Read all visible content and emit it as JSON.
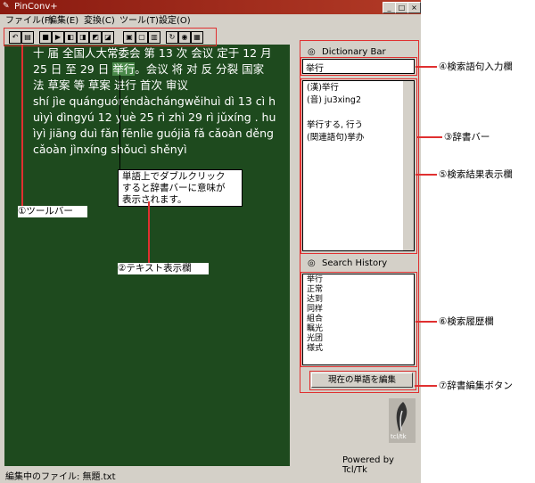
{
  "window": {
    "title": "PinConv+",
    "controls": {
      "minimize": "_",
      "maximize": "□",
      "close": "×"
    }
  },
  "menu": [
    "ファイル(F)",
    "編集(E)",
    "変換(C)",
    "ツール(T)",
    "設定(O)"
  ],
  "toolbar_icons": [
    "undo-icon",
    "paste-icon",
    "stop-icon",
    "play-icon",
    "convert-1-icon",
    "convert-2-icon",
    "convert-3-icon",
    "convert-4-icon",
    "page-1-icon",
    "page-2-icon",
    "page-3-icon",
    "refresh-icon",
    "dict-icon",
    "grid-icon"
  ],
  "editor": {
    "lines": [
      "十 届 全国人大常委会 第 13 次 会议 定于 12 月",
      "25 日 至 29 日 ",
      "法 草案 等 草案 进行 首次 审议",
      "shí jìe quánguóréndàchángwěihuì dì 13 cì h",
      "uìyì dìngyú 12 yuè 25 rì zhì 29 rì jǔxíng . hu",
      "ìyì jiāng duì fǎn fēnlìe guójiā fǎ cǎoàn děng",
      "cǎoàn jìnxíng shǒucì shěnyì"
    ],
    "selected_word": "举行",
    "line2_rest": "。会议 将 对 反 分裂 国家"
  },
  "status": {
    "label": "編集中のファイル: 無題.txt"
  },
  "dictionary": {
    "title": "Dictionary Bar",
    "search_value": "举行",
    "result_lines": [
      "(漢)举行",
      "(音) ju3xing2",
      "",
      "挙行する, 行う",
      "(関連語句)挙办"
    ]
  },
  "history": {
    "title": "Search History",
    "items": [
      "举行",
      "正常",
      "达到",
      "同样",
      "組合",
      "瞩光",
      "光团",
      "様式"
    ]
  },
  "edit_button": "現在の単語を編集",
  "powered_by": "Powered by Tcl/Tk",
  "logo_text": "tcl/tk",
  "callout": [
    "単語上でダブルクリック",
    "すると辞書バーに意味が",
    "表示されます。"
  ],
  "annotations": {
    "toolbar": "①ツールバー",
    "text_area": "②テキスト表示欄",
    "dict_bar": "③辞書バー",
    "search_input": "④検索語句入力欄",
    "search_results": "⑤検索結果表示欄",
    "history": "⑥検索履歴欄",
    "edit_btn": "⑦辞書編集ボタン"
  },
  "colors": {
    "editor_bg": "#1e4a1e",
    "title_bar": "#8a1a10",
    "annotation_red": "#e03030"
  }
}
